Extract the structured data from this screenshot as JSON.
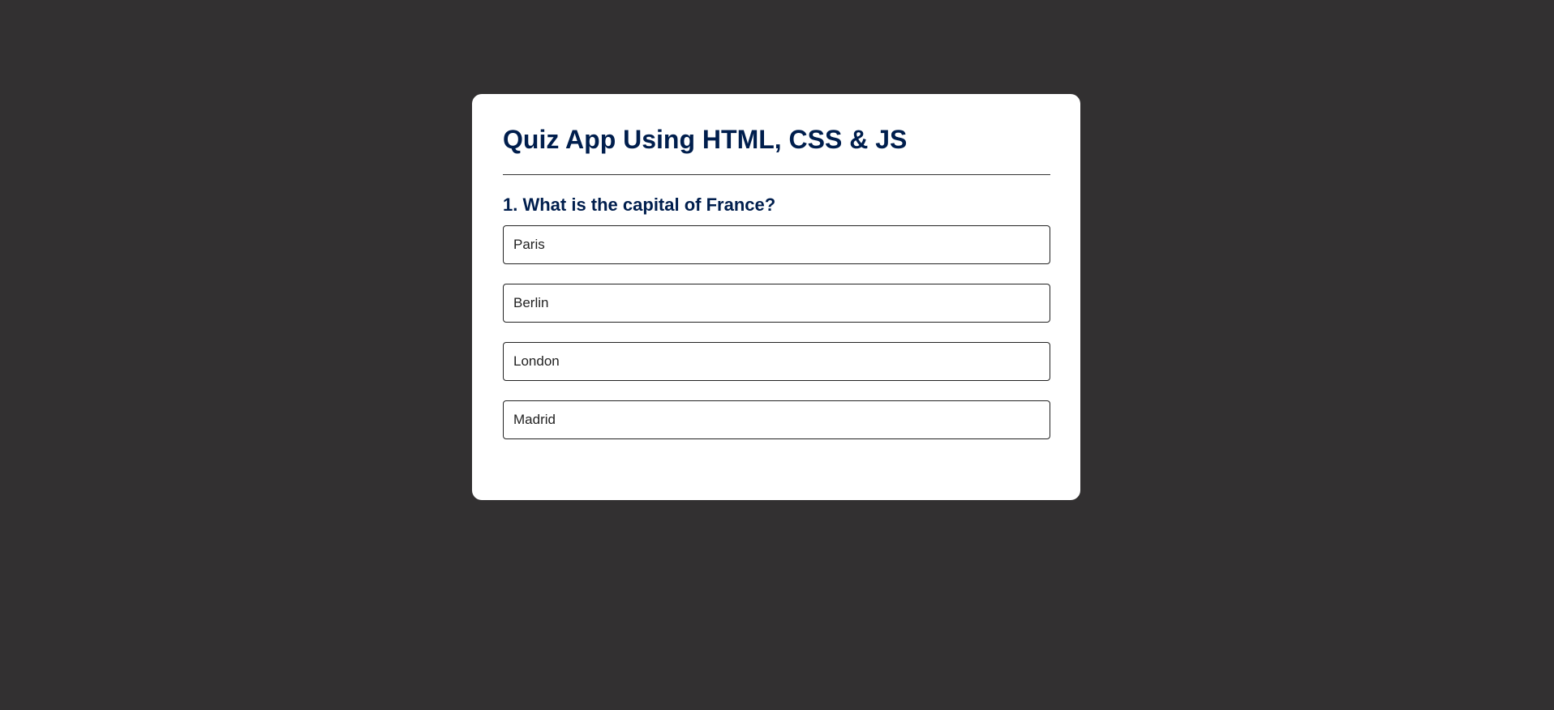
{
  "quiz": {
    "title": "Quiz App Using HTML, CSS & JS",
    "question": "1. What is the capital of France?",
    "answers": [
      {
        "label": "Paris"
      },
      {
        "label": "Berlin"
      },
      {
        "label": "London"
      },
      {
        "label": "Madrid"
      }
    ]
  },
  "colors": {
    "page_background": "#323031",
    "card_background": "#ffffff",
    "heading_color": "#001e4d",
    "button_border": "#222222"
  }
}
